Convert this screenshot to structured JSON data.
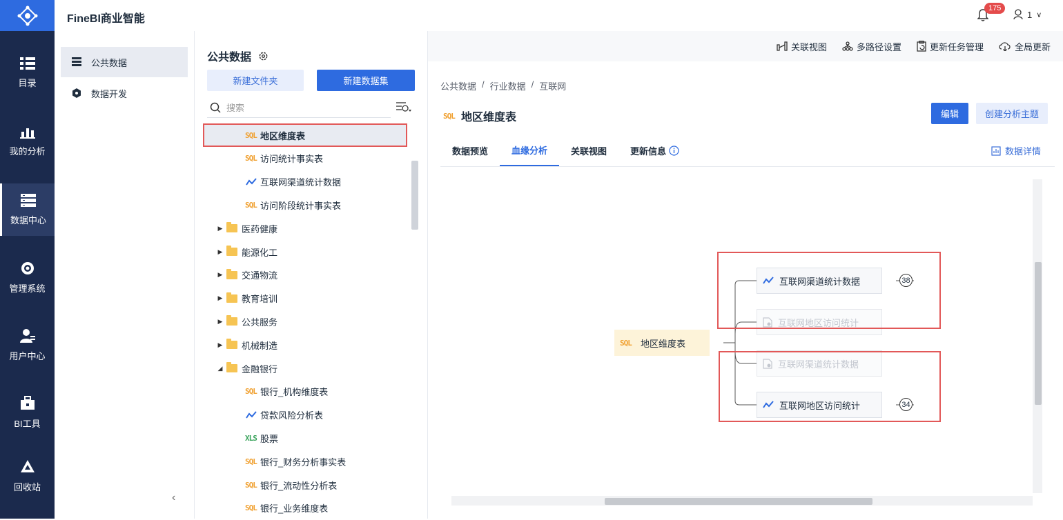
{
  "app": {
    "brand": "FineBI商业智能",
    "notifications": "175",
    "user": "1"
  },
  "rail": {
    "items": [
      {
        "label": "目录",
        "icon": "catalog-icon"
      },
      {
        "label": "我的分析",
        "icon": "analysis-icon"
      },
      {
        "label": "数据中心",
        "icon": "data-center-icon"
      },
      {
        "label": "管理系统",
        "icon": "settings-icon"
      },
      {
        "label": "用户中心",
        "icon": "user-center-icon"
      },
      {
        "label": "BI工具",
        "icon": "toolbox-icon"
      },
      {
        "label": "回收站",
        "icon": "recycle-icon"
      }
    ]
  },
  "col2": {
    "items": [
      {
        "label": "公共数据"
      },
      {
        "label": "数据开发"
      }
    ]
  },
  "tree": {
    "title": "公共数据",
    "new_folder": "新建文件夹",
    "new_dataset": "新建数据集",
    "search_placeholder": "搜索",
    "rows": [
      {
        "label": "地区维度表",
        "type": "sql",
        "indent": 2,
        "selected": true
      },
      {
        "label": "访问统计事实表",
        "type": "sql",
        "indent": 2
      },
      {
        "label": "互联网渠道统计数据",
        "type": "self",
        "indent": 2
      },
      {
        "label": "访问阶段统计事实表",
        "type": "sql",
        "indent": 2
      },
      {
        "label": "医药健康",
        "type": "folder",
        "indent": 1
      },
      {
        "label": "能源化工",
        "type": "folder",
        "indent": 1
      },
      {
        "label": "交通物流",
        "type": "folder",
        "indent": 1
      },
      {
        "label": "教育培训",
        "type": "folder",
        "indent": 1
      },
      {
        "label": "公共服务",
        "type": "folder",
        "indent": 1
      },
      {
        "label": "机械制造",
        "type": "folder",
        "indent": 1
      },
      {
        "label": "金融银行",
        "type": "folder-open",
        "indent": 1
      },
      {
        "label": "银行_机构维度表",
        "type": "sql",
        "indent": 2
      },
      {
        "label": "贷款风险分析表",
        "type": "self",
        "indent": 2
      },
      {
        "label": "股票",
        "type": "xls",
        "indent": 2
      },
      {
        "label": "银行_财务分析事实表",
        "type": "sql",
        "indent": 2
      },
      {
        "label": "银行_流动性分析表",
        "type": "sql",
        "indent": 2
      },
      {
        "label": "银行_业务维度表",
        "type": "sql",
        "indent": 2
      }
    ]
  },
  "toolbar": {
    "items": [
      {
        "label": "关联视图",
        "icon": "relation-view-icon"
      },
      {
        "label": "多路径设置",
        "icon": "multipath-icon"
      },
      {
        "label": "更新任务管理",
        "icon": "update-task-icon"
      },
      {
        "label": "全局更新",
        "icon": "cloud-update-icon"
      }
    ]
  },
  "breadcrumb": [
    "公共数据",
    "行业数据",
    "互联网"
  ],
  "title": "地区维度表",
  "buttons": {
    "edit": "编辑",
    "create": "创建分析主题"
  },
  "tabs": [
    "数据预览",
    "血缘分析",
    "关联视图",
    "更新信息"
  ],
  "detail": "数据详情",
  "lineage": {
    "source": "地区维度表",
    "nodes": [
      {
        "label": "互联网渠道统计数据",
        "active": true,
        "count": "38"
      },
      {
        "label": "互联网地区访问统计",
        "active": false
      },
      {
        "label": "互联网渠道统计数据",
        "active": false
      },
      {
        "label": "互联网地区访问统计",
        "active": true,
        "count": "34"
      }
    ]
  },
  "colors": {
    "primary": "#2e6be0",
    "rail": "#1b2a4d",
    "highlight": "#e25858",
    "sql": "#f0a030"
  }
}
